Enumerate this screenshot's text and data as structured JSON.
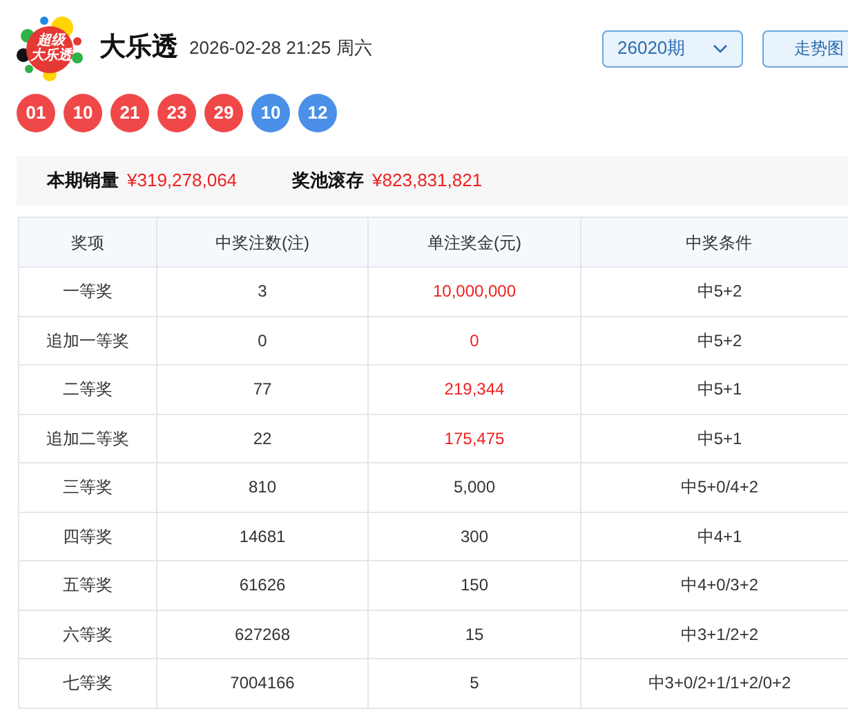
{
  "logo": {
    "line_1": "超级",
    "line_2": "大乐透"
  },
  "title": "大乐透",
  "draw_time": "2026-02-28 21:25 周六",
  "issue_select": {
    "value": "26020期"
  },
  "trend_button": "走势图",
  "balls": [
    {
      "number": "01",
      "color": "#f04848"
    },
    {
      "number": "10",
      "color": "#f04848"
    },
    {
      "number": "21",
      "color": "#f04848"
    },
    {
      "number": "23",
      "color": "#f04848"
    },
    {
      "number": "29",
      "color": "#f04848"
    },
    {
      "number": "10",
      "color": "#4a8fe8"
    },
    {
      "number": "12",
      "color": "#4a8fe8"
    }
  ],
  "summary": [
    {
      "label": "本期销量",
      "value": "¥319,278,064"
    },
    {
      "label": "奖池滚存",
      "value": "¥823,831,821"
    }
  ],
  "table": {
    "columns": [
      "奖项",
      "中奖注数(注)",
      "单注奖金(元)",
      "中奖条件"
    ],
    "rows": [
      {
        "prize": "一等奖",
        "count": "3",
        "amount": "10,000,000",
        "highlight": true,
        "condition": "中5+2"
      },
      {
        "prize": "追加一等奖",
        "count": "0",
        "amount": "0",
        "highlight": true,
        "condition": "中5+2"
      },
      {
        "prize": "二等奖",
        "count": "77",
        "amount": "219,344",
        "highlight": true,
        "condition": "中5+1"
      },
      {
        "prize": "追加二等奖",
        "count": "22",
        "amount": "175,475",
        "highlight": true,
        "condition": "中5+1"
      },
      {
        "prize": "三等奖",
        "count": "810",
        "amount": "5,000",
        "highlight": false,
        "condition": "中5+0/4+2"
      },
      {
        "prize": "四等奖",
        "count": "14681",
        "amount": "300",
        "highlight": false,
        "condition": "中4+1"
      },
      {
        "prize": "五等奖",
        "count": "61626",
        "amount": "150",
        "highlight": false,
        "condition": "中4+0/3+2"
      },
      {
        "prize": "六等奖",
        "count": "627268",
        "amount": "15",
        "highlight": false,
        "condition": "中3+1/2+2"
      },
      {
        "prize": "七等奖",
        "count": "7004166",
        "amount": "5",
        "highlight": false,
        "condition": "中3+0/2+1/1+2/0+2"
      }
    ]
  }
}
